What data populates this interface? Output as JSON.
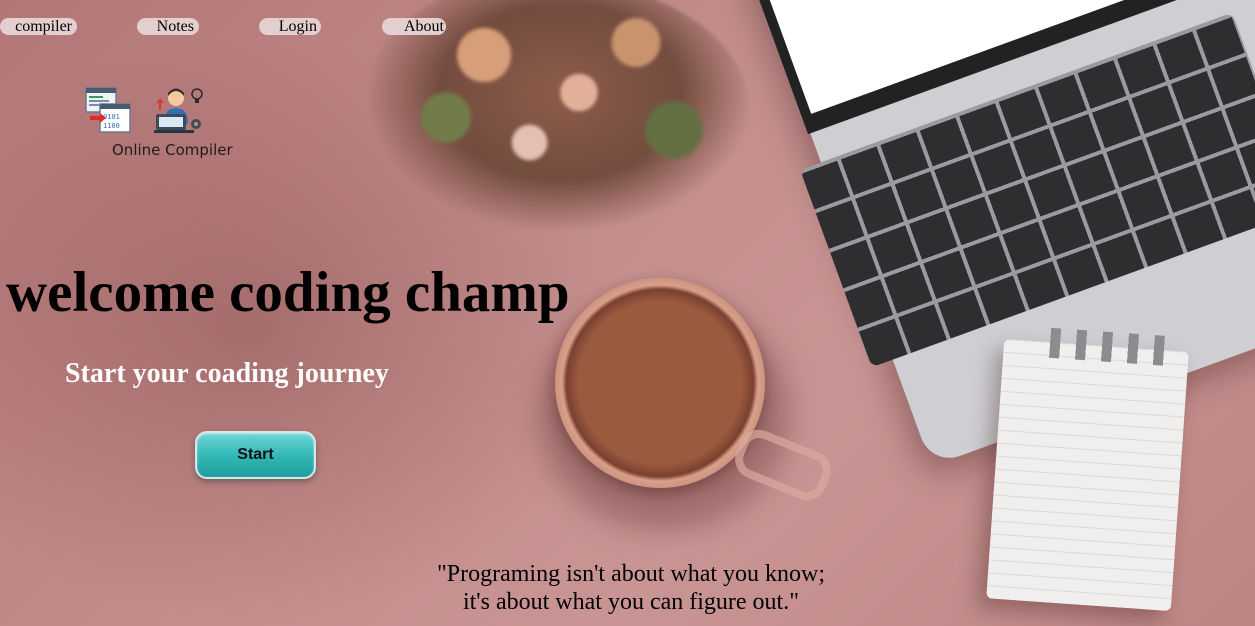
{
  "nav": {
    "items": [
      {
        "label": "compiler"
      },
      {
        "label": "Notes"
      },
      {
        "label": "Login"
      },
      {
        "label": "About"
      }
    ]
  },
  "logo": {
    "caption": "Online Compiler",
    "icons": [
      "code-window-icon",
      "developer-laptop-icon"
    ]
  },
  "hero": {
    "title": "welcome coding champ",
    "subtitle": "Start your coading journey",
    "start_label": "Start"
  },
  "quote": {
    "line1": "\"Programing isn't about what you know;",
    "line2": "it's about what you can figure out.\""
  },
  "colors": {
    "nav_button_bg": "#e3cfd0",
    "start_button": "#32b9b8",
    "background": "#b98080",
    "subtitle_text": "#ffffff"
  }
}
